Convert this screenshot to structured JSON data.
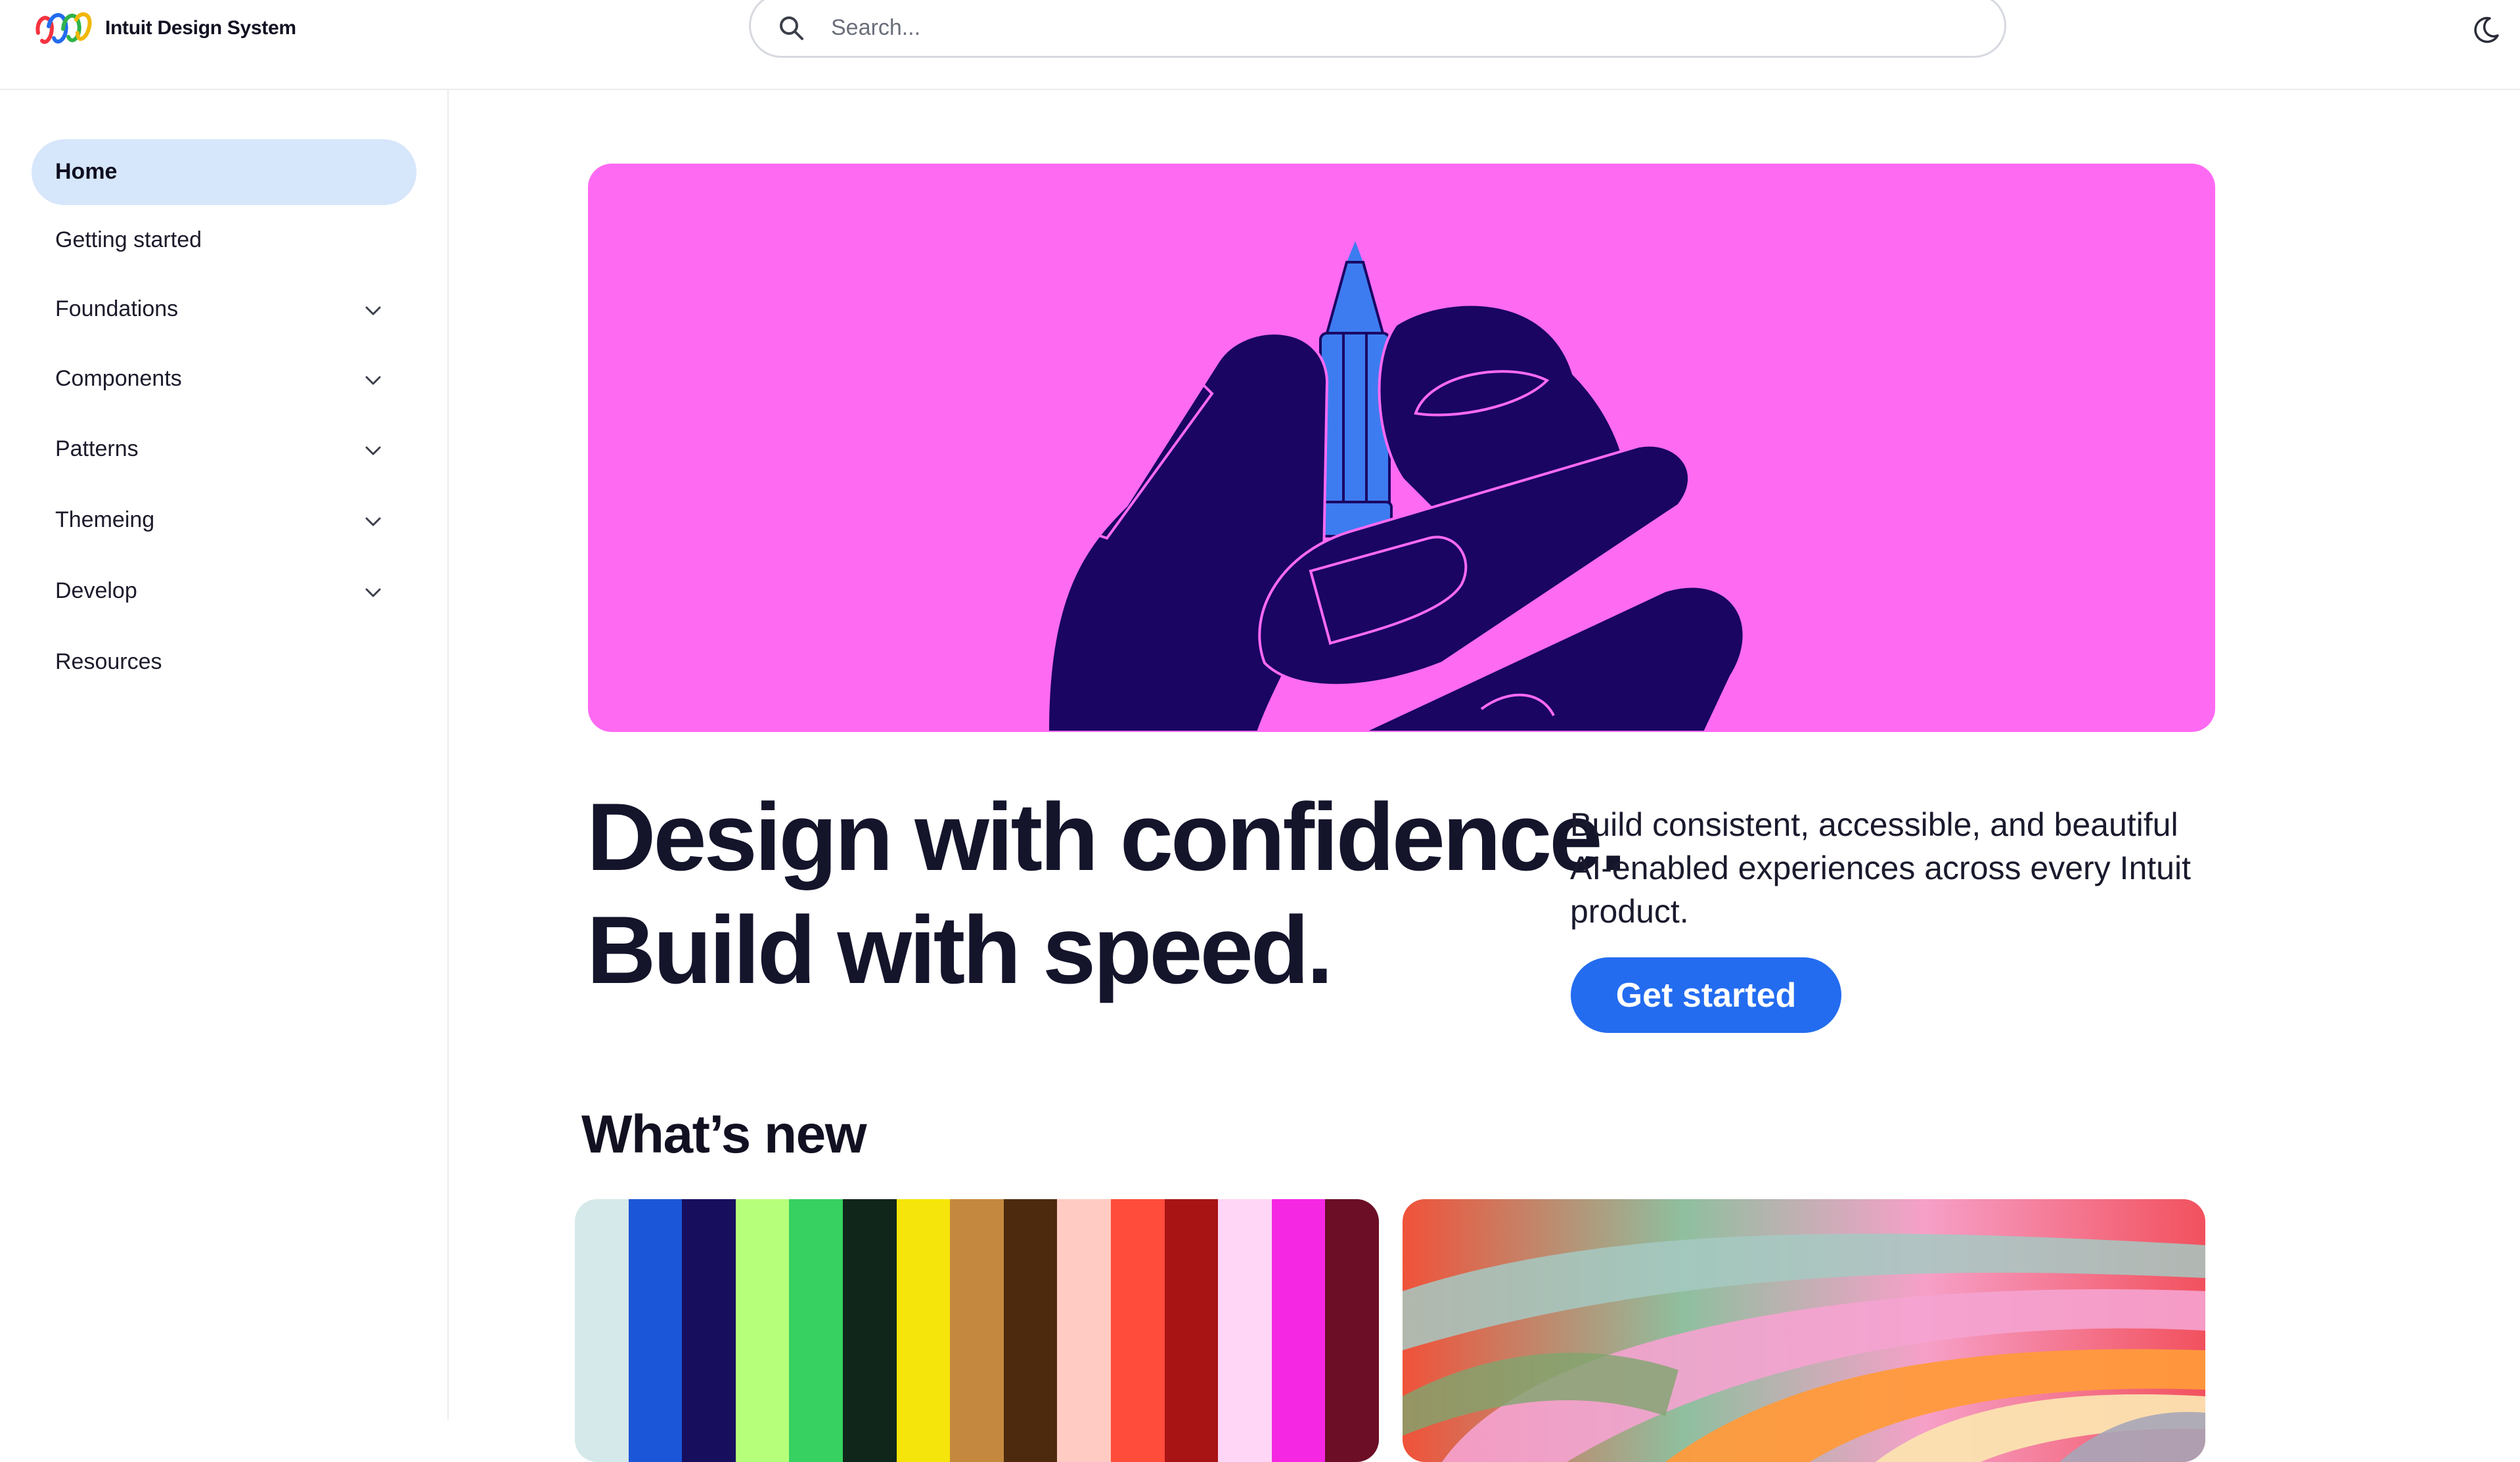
{
  "header": {
    "brand": "Intuit Design System",
    "search_placeholder": "Search..."
  },
  "sidebar": {
    "items": [
      {
        "label": "Home",
        "active": true,
        "expandable": false
      },
      {
        "label": "Getting started",
        "active": false,
        "expandable": false
      },
      {
        "label": "Foundations",
        "active": false,
        "expandable": true
      },
      {
        "label": "Components",
        "active": false,
        "expandable": true
      },
      {
        "label": "Patterns",
        "active": false,
        "expandable": true
      },
      {
        "label": "Themeing",
        "active": false,
        "expandable": true
      },
      {
        "label": "Develop",
        "active": false,
        "expandable": true
      },
      {
        "label": "Resources",
        "active": false,
        "expandable": false
      }
    ]
  },
  "hero": {
    "background_color": "#ff6af3",
    "illustration": "hand-holding-pencil"
  },
  "main": {
    "headline_line1": "Design with confidence.",
    "headline_line2": "Build with speed.",
    "subtext": "Build consistent, accessible, and beautiful AI-enabled experiences across every Intuit product.",
    "cta_label": "Get started",
    "whats_new_title": "What’s new"
  },
  "cards": {
    "palette_stripes": [
      "#d5e9ea",
      "#1c56d8",
      "#170f5e",
      "#b6ff7a",
      "#36d160",
      "#10261a",
      "#f5e50a",
      "#c4893e",
      "#4d2a0e",
      "#ffcbc2",
      "#ff4c3b",
      "#a81414",
      "#ffd6f5",
      "#f527e3",
      "#6b0e26"
    ]
  },
  "colors": {
    "accent": "#236cf0",
    "nav_active": "#d6e6fb",
    "illustration_navy": "#1a0563",
    "pencil_blue": "#3d7cf0"
  }
}
